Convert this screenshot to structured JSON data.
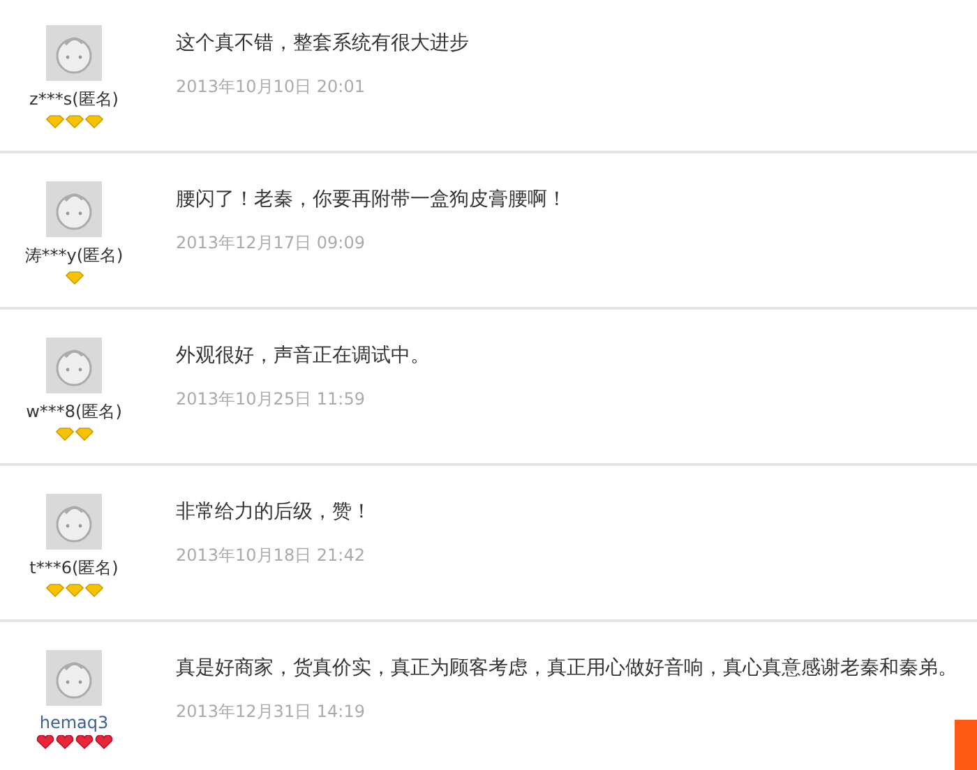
{
  "reviews": [
    {
      "user": "z***s(匿名)",
      "linked": false,
      "badges": [
        {
          "kind": "diamond"
        },
        {
          "kind": "diamond"
        },
        {
          "kind": "diamond"
        }
      ],
      "text": "这个真不错，整套系统有很大进步",
      "date": "2013年10月10日 20:01"
    },
    {
      "user": "涛***y(匿名)",
      "linked": false,
      "badges": [
        {
          "kind": "diamond"
        }
      ],
      "text": "腰闪了！老秦，你要再附带一盒狗皮膏腰啊！",
      "date": "2013年12月17日 09:09"
    },
    {
      "user": "w***8(匿名)",
      "linked": false,
      "badges": [
        {
          "kind": "diamond"
        },
        {
          "kind": "diamond"
        }
      ],
      "text": "外观很好，声音正在调试中。",
      "date": "2013年10月25日 11:59"
    },
    {
      "user": "t***6(匿名)",
      "linked": false,
      "badges": [
        {
          "kind": "diamond"
        },
        {
          "kind": "diamond"
        },
        {
          "kind": "diamond"
        }
      ],
      "text": "非常给力的后级，赞！",
      "date": "2013年10月18日 21:42"
    },
    {
      "user": "hemaq3",
      "linked": true,
      "badges": [
        {
          "kind": "heart"
        },
        {
          "kind": "heart"
        },
        {
          "kind": "heart"
        },
        {
          "kind": "heart"
        }
      ],
      "text": "真是好商家，货真价实，真正为顾客考虑，真正用心做好音响，真心真意感谢老秦和秦弟。",
      "date": "2013年12月31日 14:19"
    }
  ]
}
